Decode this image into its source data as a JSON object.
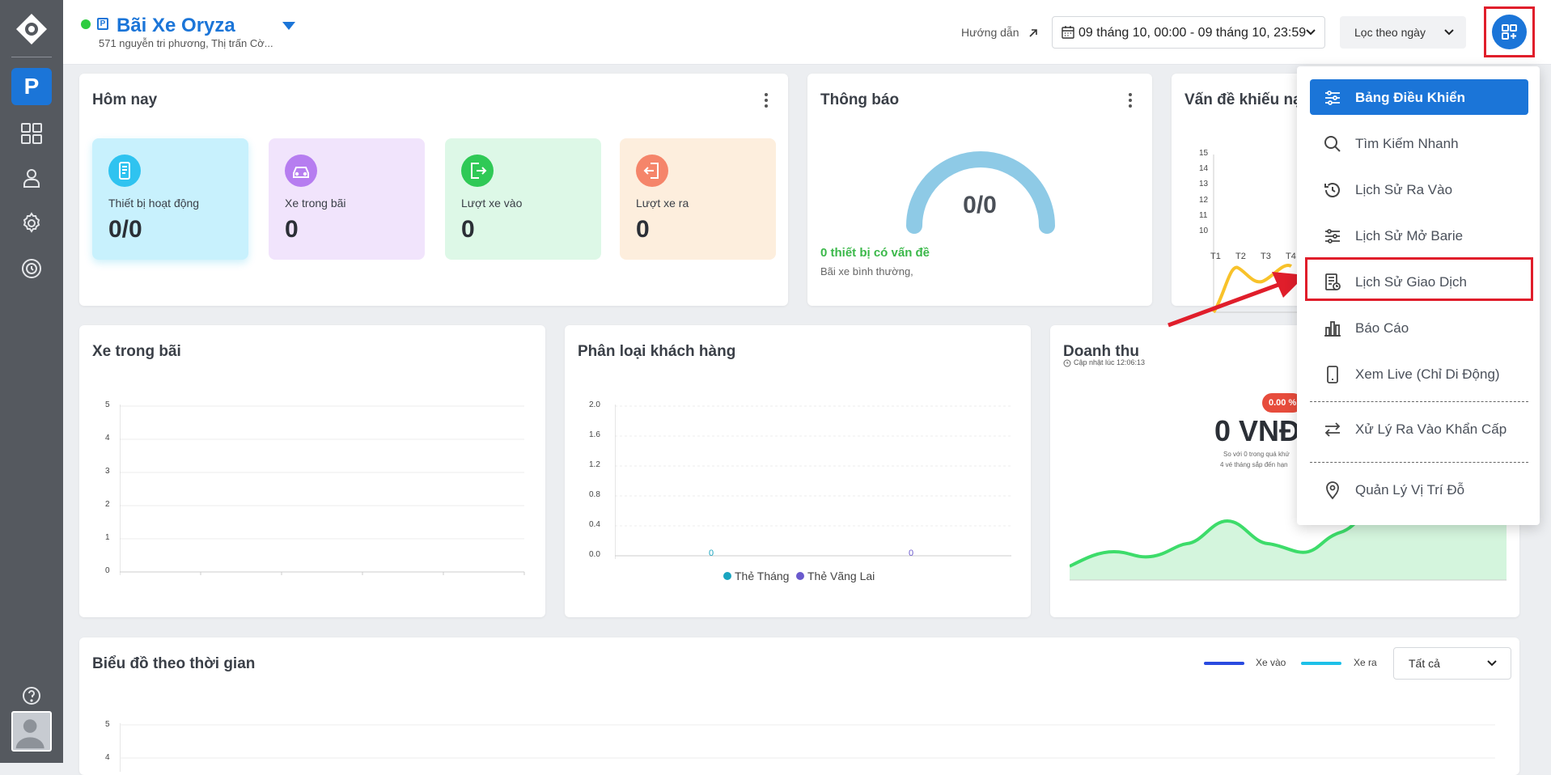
{
  "header": {
    "lot_name": "Bãi Xe Oryza",
    "lot_address": "571 nguyễn tri phương, Thị trấn Cờ...",
    "guide_label": "Hướng dẫn",
    "date_range": "09 tháng 10, 00:00 - 09 tháng 10, 23:59",
    "filter_label": "Lọc theo ngày",
    "status_color": "#2ecc40",
    "accent_color": "#1b75d8"
  },
  "today": {
    "title": "Hôm nay",
    "stats": [
      {
        "label": "Thiết bị hoạt động",
        "value": "0/0",
        "icon": "device-icon"
      },
      {
        "label": "Xe trong bãi",
        "value": "0",
        "icon": "car-icon"
      },
      {
        "label": "Lượt xe vào",
        "value": "0",
        "icon": "entry-icon"
      },
      {
        "label": "Lượt xe ra",
        "value": "0",
        "icon": "exit-icon"
      }
    ]
  },
  "notifications": {
    "title": "Thông báo",
    "gauge_value": "0/0",
    "issues_text": "0 thiết bị có vấn đề",
    "status_text": "Bãi xe bình thường,"
  },
  "complaints": {
    "title": "Vấn đề khiếu nại",
    "y_ticks": [
      "15",
      "14",
      "13",
      "12",
      "11",
      "10"
    ],
    "x_ticks": [
      "T1",
      "T2",
      "T3",
      "T4"
    ]
  },
  "cars_in_lot": {
    "title": "Xe trong bãi",
    "y_ticks": [
      "5",
      "4",
      "3",
      "2",
      "1",
      "0"
    ]
  },
  "customer_types": {
    "title": "Phân loại khách hàng",
    "y_ticks": [
      "2.0",
      "1.6",
      "1.2",
      "0.8",
      "0.4",
      "0.0"
    ],
    "point_labels": [
      "0",
      "0"
    ],
    "legend": [
      "Thẻ Tháng",
      "Thẻ Vãng Lai"
    ]
  },
  "revenue": {
    "title": "Doanh thu",
    "updated": "Cập nhật lúc 12:06:13",
    "badge": "0.00 %",
    "amount": "0 VNĐ",
    "compare_line1": "So với 0 trong quá khứ",
    "compare_line2": "4 vé tháng sắp đến hạn"
  },
  "time_chart": {
    "title": "Biểu đồ theo thời gian",
    "legend_in": "Xe vào",
    "legend_out": "Xe ra",
    "select_value": "Tất cả",
    "y_ticks": [
      "5",
      "4"
    ]
  },
  "menu": {
    "items": [
      {
        "label": "Bảng Điều Khiển",
        "icon": "sliders-icon"
      },
      {
        "label": "Tìm Kiếm Nhanh",
        "icon": "search-icon"
      },
      {
        "label": "Lịch Sử Ra Vào",
        "icon": "history-icon"
      },
      {
        "label": "Lịch Sử Mở Barie",
        "icon": "sliders-icon"
      },
      {
        "label": "Lịch Sử Giao Dịch",
        "icon": "receipt-icon"
      },
      {
        "label": "Báo Cáo",
        "icon": "bar-chart-icon"
      },
      {
        "label": "Xem Live (Chỉ Di Động)",
        "icon": "mobile-icon"
      },
      {
        "label": "Xử Lý Ra Vào Khẩn Cấp",
        "icon": "swap-icon"
      },
      {
        "label": "Quản Lý Vị Trí Đỗ",
        "icon": "location-pin-icon"
      }
    ]
  }
}
